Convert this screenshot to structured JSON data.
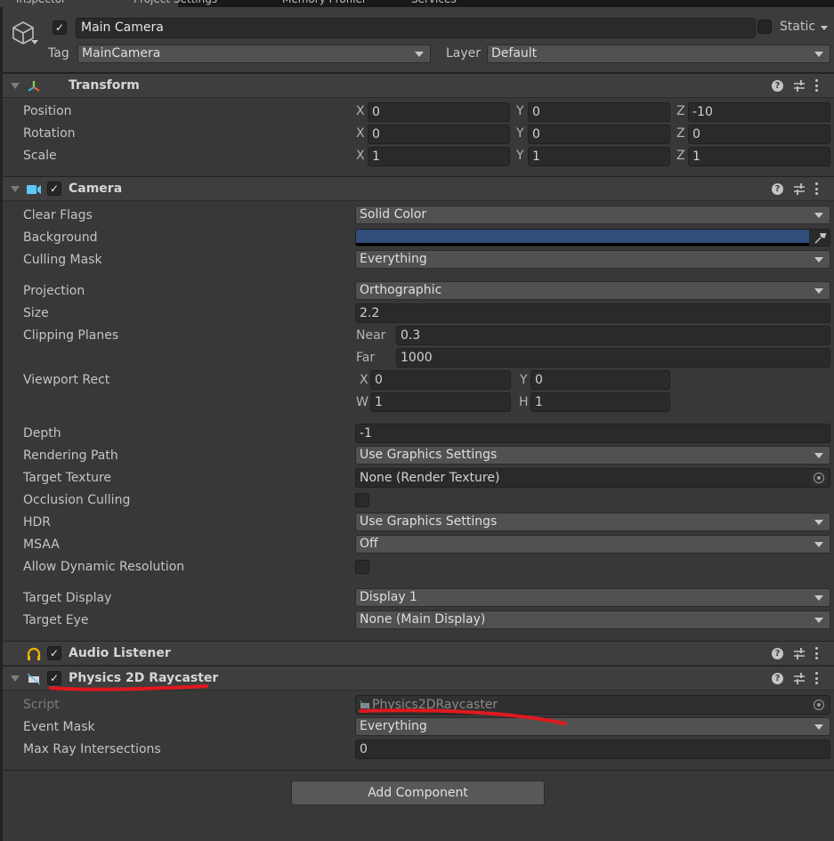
{
  "tabs": [
    {
      "label": "Inspector",
      "active": true
    },
    {
      "label": "Project Settings",
      "active": false
    },
    {
      "label": "Memory Profiler",
      "active": false
    },
    {
      "label": "Services",
      "active": false
    }
  ],
  "gameobject": {
    "active": true,
    "name": "Main Camera",
    "static_label": "Static",
    "static": false,
    "tag_label": "Tag",
    "tag_value": "MainCamera",
    "layer_label": "Layer",
    "layer_value": "Default"
  },
  "transform": {
    "title": "Transform",
    "rows": [
      {
        "label": "Position",
        "x": "0",
        "y": "0",
        "z": "-10"
      },
      {
        "label": "Rotation",
        "x": "0",
        "y": "0",
        "z": "0"
      },
      {
        "label": "Scale",
        "x": "1",
        "y": "1",
        "z": "1"
      }
    ],
    "axis": {
      "x": "X",
      "y": "Y",
      "z": "Z"
    }
  },
  "camera": {
    "title": "Camera",
    "enabled": true,
    "clear_flags": {
      "label": "Clear Flags",
      "value": "Solid Color"
    },
    "background": {
      "label": "Background",
      "color": "#314D79"
    },
    "culling_mask": {
      "label": "Culling Mask",
      "value": "Everything"
    },
    "projection": {
      "label": "Projection",
      "value": "Orthographic"
    },
    "size": {
      "label": "Size",
      "value": "2.2"
    },
    "clipping": {
      "label": "Clipping Planes",
      "near_label": "Near",
      "near": "0.3",
      "far_label": "Far",
      "far": "1000"
    },
    "viewport": {
      "label": "Viewport Rect",
      "x_label": "X",
      "x": "0",
      "y_label": "Y",
      "y": "0",
      "w_label": "W",
      "w": "1",
      "h_label": "H",
      "h": "1"
    },
    "depth": {
      "label": "Depth",
      "value": "-1"
    },
    "rendering_path": {
      "label": "Rendering Path",
      "value": "Use Graphics Settings"
    },
    "target_texture": {
      "label": "Target Texture",
      "value": "None (Render Texture)"
    },
    "occlusion_culling": {
      "label": "Occlusion Culling",
      "checked": false
    },
    "hdr": {
      "label": "HDR",
      "value": "Use Graphics Settings"
    },
    "msaa": {
      "label": "MSAA",
      "value": "Off"
    },
    "dynamic_resolution": {
      "label": "Allow Dynamic Resolution",
      "checked": false
    },
    "target_display": {
      "label": "Target Display",
      "value": "Display 1"
    },
    "target_eye": {
      "label": "Target Eye",
      "value": "None (Main Display)"
    }
  },
  "audio_listener": {
    "title": "Audio Listener",
    "enabled": true
  },
  "raycaster": {
    "title": "Physics 2D Raycaster",
    "enabled": true,
    "script": {
      "label": "Script",
      "value": "Physics2DRaycaster"
    },
    "event_mask": {
      "label": "Event Mask",
      "value": "Everything"
    },
    "max_ray": {
      "label": "Max Ray Intersections",
      "value": "0"
    }
  },
  "add_component_label": "Add Component",
  "colors": {
    "annotation_red": "#E0191E",
    "panel_bg": "#383838",
    "header_bg": "#3E3E3E"
  },
  "check_glyph": "✓",
  "help_glyph": "?"
}
